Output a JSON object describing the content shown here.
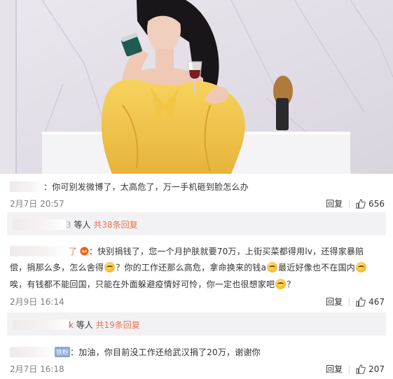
{
  "comments": [
    {
      "username_suffix": "",
      "text": "：你可别发微博了，太高危了，万一手机砸到脸怎么办",
      "date": "2月7日 20:57",
      "reply_label": "回复",
      "likes": "656",
      "replies_users_suffix": "3",
      "replies_users_text": "等人",
      "replies_count_text": "共38条回复"
    },
    {
      "username_suffix": "了",
      "text_line1": "：快别捐钱了，您一个月护肤就要70万，上街买菜都得用lv，还得家暴赔",
      "text_line2a": "偿，捐那么多，怎么舍得",
      "text_line2b": "？你的工作还那么高危，拿命换来的钱a",
      "text_line2c": "最近好像也不在国内",
      "text_line3a": "唉，有钱都不能回国，只能在外面躲避疫情好可怜，你一定也很想家吧",
      "text_line3b": "？",
      "date": "2月9日 16:14",
      "reply_label": "回复",
      "likes": "467",
      "replies_users_suffix": "k",
      "replies_users_text": "等人",
      "replies_count_text": "共19条回复"
    },
    {
      "badge": "铁粉",
      "text": "：加油，你目前没工作还给武汉捐了20万，谢谢你",
      "date": "2月7日 16:18",
      "reply_label": "回复",
      "likes": "207"
    }
  ]
}
